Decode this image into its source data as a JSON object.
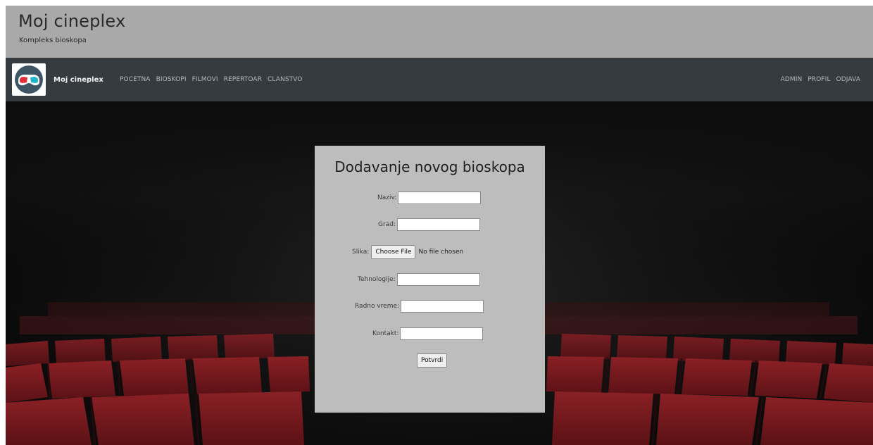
{
  "header": {
    "title": "Moj cineplex",
    "subtitle": "Kompleks bioskopa"
  },
  "navbar": {
    "brand": "Moj cineplex",
    "logo_icon": "3d-glasses-icon",
    "left_links": [
      "POCETNA",
      "BIOSKOPI",
      "FILMOVI",
      "REPERTOAR",
      "CLANSTVO"
    ],
    "right_links": [
      "ADMIN",
      "PROFIL",
      "ODJAVA"
    ]
  },
  "form": {
    "title": "Dodavanje novog bioskopa",
    "fields": {
      "naziv": {
        "label": "Naziv:",
        "value": ""
      },
      "grad": {
        "label": "Grad:",
        "value": ""
      },
      "slika": {
        "label": "Slika:",
        "button": "Choose File",
        "status": "No file chosen"
      },
      "tehnologije": {
        "label": "Tehnologije:",
        "value": ""
      },
      "radno_vreme": {
        "label": "Radno vreme:",
        "value": ""
      },
      "kontakt": {
        "label": "Kontakt:",
        "value": ""
      }
    },
    "submit_label": "Potvrdi"
  },
  "colors": {
    "header_bg": "#a9a9a9",
    "navbar_bg": "#363b40",
    "panel_bg": "#bdbdbd",
    "seat_red": "#7a1a1e"
  }
}
